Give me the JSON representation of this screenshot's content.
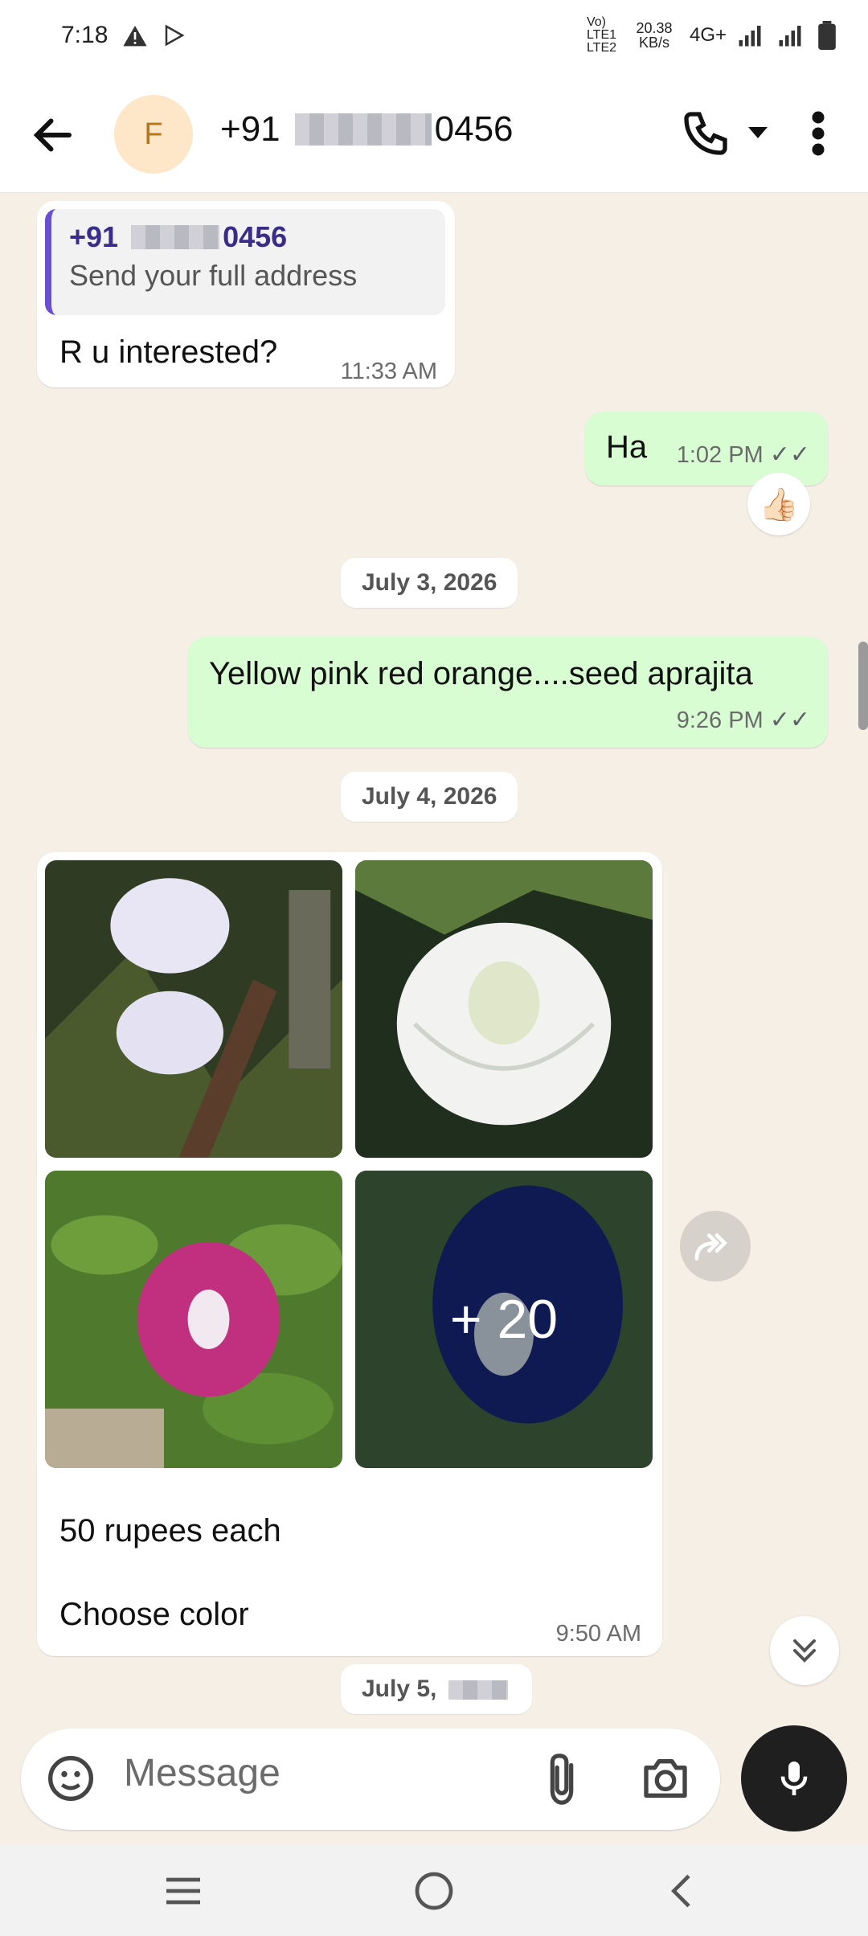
{
  "status": {
    "time": "7:18",
    "net_speed": "20.38 KB/s",
    "volte": "Vo) LTE1 LTE2",
    "network": "4G+"
  },
  "header": {
    "avatar_initial": "F",
    "contact_prefix": "+91",
    "contact_suffix": "0456"
  },
  "messages": {
    "m1": {
      "quote_prefix": "+91",
      "quote_suffix": "0456",
      "quote_text": "Send your full address",
      "text": "R u interested?",
      "time": "11:33 AM"
    },
    "m2": {
      "text": "Ha",
      "time": "1:02 PM",
      "reaction": "👍🏻"
    },
    "date1": "July 3, 2026",
    "m3": {
      "text": "Yellow pink red orange....seed aprajita",
      "time": "9:26 PM"
    },
    "date2": "July 4, 2026",
    "m4": {
      "more_count": "+ 20",
      "line1": "50 rupees each",
      "line2": "Choose color",
      "time": "9:50 AM"
    },
    "date3_prefix": "July 5,"
  },
  "composer": {
    "placeholder": "Message"
  },
  "colors": {
    "chat_bg": "#f5efe6",
    "outgoing": "#d9fdd3",
    "quote_bar": "#6b4fd3",
    "mic_button": "#1f1f1f"
  }
}
